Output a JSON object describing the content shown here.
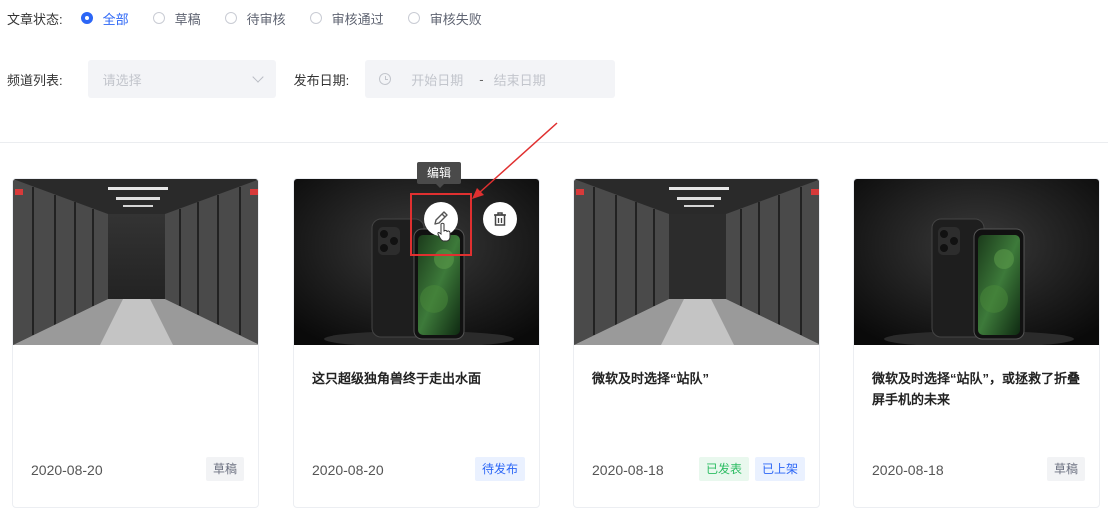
{
  "status": {
    "label": "文章状态:",
    "options": [
      "全部",
      "草稿",
      "待审核",
      "审核通过",
      "审核失败"
    ],
    "selected_index": 0
  },
  "channel": {
    "label": "频道列表:",
    "placeholder": "请选择"
  },
  "publish_date": {
    "label": "发布日期:",
    "start_placeholder": "开始日期",
    "separator": "-",
    "end_placeholder": "结束日期"
  },
  "tooltip": {
    "text": "编辑"
  },
  "cards": [
    {
      "image": "server-room",
      "title": "",
      "date": "2020-08-20",
      "tags": [
        {
          "text": "草稿",
          "color": "#6b7080"
        }
      ]
    },
    {
      "image": "phone",
      "title": "这只超级独角兽终于走出水面",
      "date": "2020-08-20",
      "tags": [
        {
          "text": "待发布",
          "color": "#2c66f6"
        }
      ]
    },
    {
      "image": "server-room",
      "title": "微软及时选择“站队”",
      "date": "2020-08-18",
      "tags": [
        {
          "text": "已发表",
          "color": "#2dbd63"
        },
        {
          "text": "已上架",
          "color": "#2c66f6"
        }
      ]
    },
    {
      "image": "phone",
      "title": "微软及时选择“站队”，或拯救了折叠屏手机的未来",
      "date": "2020-08-18",
      "tags": [
        {
          "text": "草稿",
          "color": "#6b7080"
        }
      ]
    }
  ],
  "icons": {
    "edit": "pencil-icon",
    "delete": "trash-icon",
    "select_arrow": "chevron-down-icon",
    "date_icon": "clock-icon"
  },
  "colors": {
    "accent": "#2c66f6",
    "annotation": "#e03030"
  }
}
